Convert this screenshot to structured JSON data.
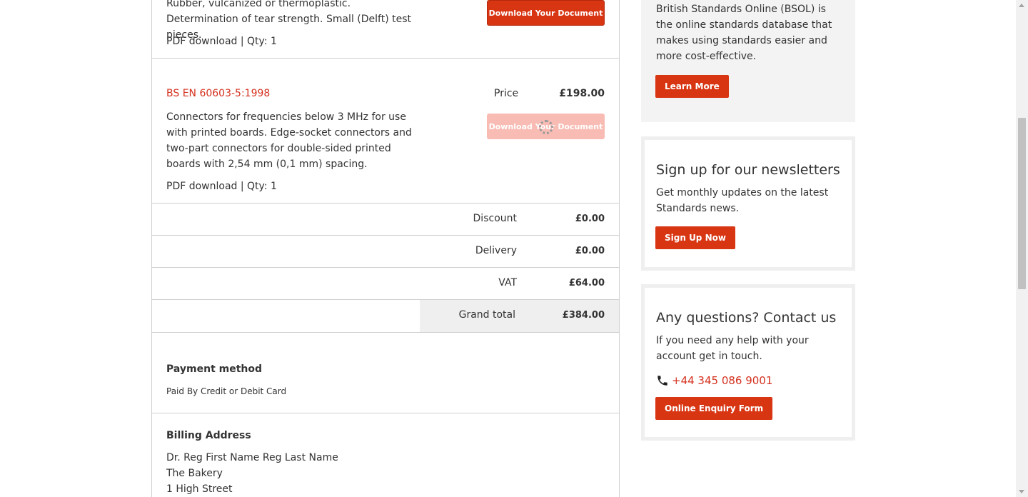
{
  "order": {
    "items": [
      {
        "description": "Rubber, vulcanized or thermoplastic. Determination of tear strength. Small (Delft) test pieces.",
        "qty_line": "PDF download | Qty: 1",
        "button_label": "Download Your Document"
      },
      {
        "code": "BS EN 60603-5:1998",
        "description": "Connectors for frequencies below 3 MHz for use with printed boards. Edge-socket connectors and two-part connectors for double-sided printed boards with 2,54 mm (0,1 mm) spacing.",
        "price_label": "Price",
        "price": "£198.00",
        "qty_line": "PDF download | Qty: 1",
        "button_label": "Download Your Document"
      }
    ],
    "summary": {
      "discount_label": "Discount",
      "discount": "£0.00",
      "delivery_label": "Delivery",
      "delivery": "£0.00",
      "vat_label": "VAT",
      "vat": "£64.00",
      "grand_total_label": "Grand total",
      "grand_total": "£384.00"
    },
    "payment": {
      "title": "Payment method",
      "text": "Paid By Credit or Debit Card"
    },
    "billing": {
      "title": "Billing Address",
      "lines": [
        "Dr. Reg First Name Reg Last Name",
        "The Bakery",
        "1 High Street"
      ]
    }
  },
  "sidebar": {
    "bsol": {
      "text": "British Standards Online (BSOL) is the online standards database that makes using standards easier and more cost-effective.",
      "button": "Learn More"
    },
    "newsletter": {
      "title": "Sign up for our newsletters",
      "text": "Get monthly updates on the latest Standards news.",
      "button": "Sign Up Now"
    },
    "contact": {
      "title": "Any questions? Contact us",
      "text": "If you need any help with your account get in touch.",
      "phone": "+44 345 086 9001",
      "button": "Online Enquiry Form"
    }
  },
  "icons": {
    "phone": "phone-icon",
    "spinner": "loading-spinner-icon"
  },
  "colors": {
    "accent": "#d83513",
    "link": "#d5311f",
    "disabled_button": "#f8bcb4"
  }
}
